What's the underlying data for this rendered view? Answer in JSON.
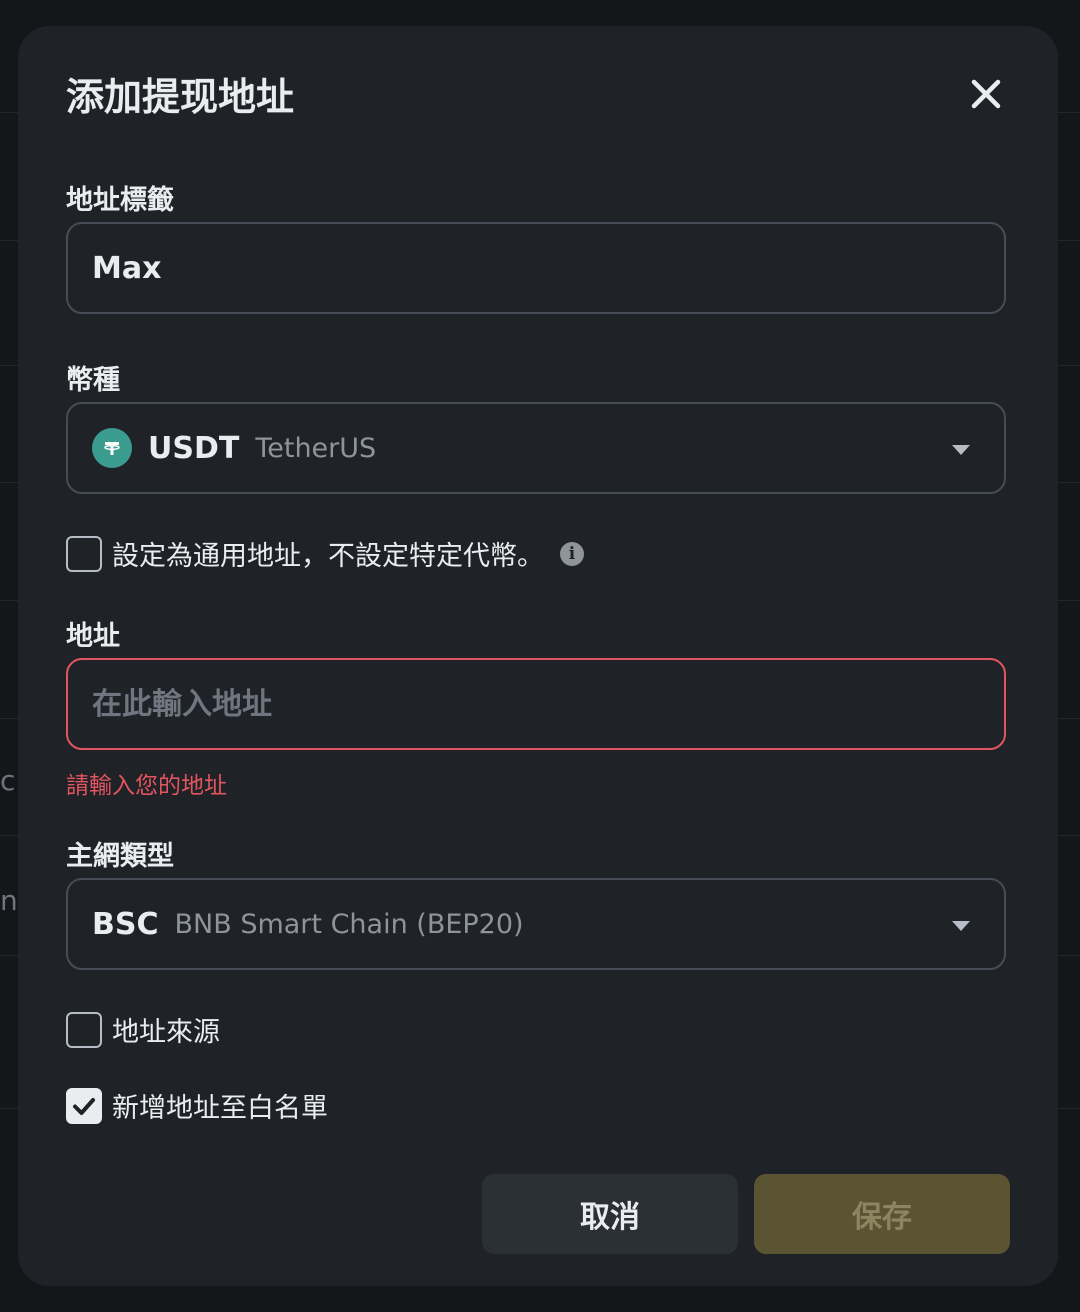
{
  "background": {
    "fragments": [
      "c",
      "ng"
    ]
  },
  "modal": {
    "title": "添加提现地址",
    "close_icon": "close-icon"
  },
  "label_field": {
    "label": "地址標籤",
    "value": "Max"
  },
  "coin_field": {
    "label": "幣種",
    "coin_icon": "usdt-logo-icon",
    "symbol": "USDT",
    "name": "TetherUS"
  },
  "universal_address": {
    "label": "設定為通用地址，不設定特定代幣。",
    "checked": false,
    "info_icon": "info-icon"
  },
  "address_field": {
    "label": "地址",
    "value": "",
    "placeholder": "在此輸入地址",
    "error": "請輸入您的地址"
  },
  "network_field": {
    "label": "主網類型",
    "code": "BSC",
    "name": "BNB Smart Chain (BEP20)"
  },
  "address_source": {
    "label": "地址來源",
    "checked": false
  },
  "whitelist": {
    "label": "新增地址至白名單",
    "checked": true
  },
  "buttons": {
    "cancel": "取消",
    "save": "保存"
  },
  "colors": {
    "background": "#141619",
    "modal": "#1f2226",
    "error": "#e2545f",
    "save_button": "#5b5433",
    "coin_logo": "#3a9c8e"
  }
}
